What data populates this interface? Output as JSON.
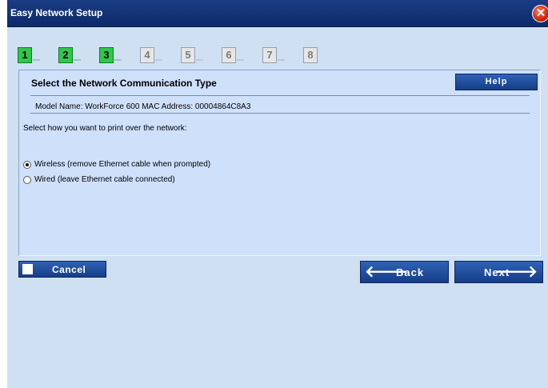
{
  "window": {
    "title": "Easy Network Setup",
    "close_glyph": "✕"
  },
  "steps": [
    {
      "num": "1",
      "dots": "▫▫▫",
      "state": "done"
    },
    {
      "num": "2",
      "dots": "▫▫▫",
      "state": "done"
    },
    {
      "num": "3",
      "dots": "▫▫▫",
      "state": "done"
    },
    {
      "num": "4",
      "dots": "▫▫▫",
      "state": "pending"
    },
    {
      "num": "5",
      "dots": "▫▫▫",
      "state": "pending"
    },
    {
      "num": "6",
      "dots": "▫▫▫",
      "state": "pending"
    },
    {
      "num": "7",
      "dots": "▫▫▫",
      "state": "pending"
    },
    {
      "num": "8",
      "dots": "",
      "state": "pending"
    }
  ],
  "panel": {
    "title": "Select the Network Communication Type",
    "help_label": "Help",
    "model_info": "Model Name: WorkForce 600    MAC Address: 00004864C8A3",
    "instruction": "Select how you want to print over the network:",
    "options": [
      {
        "label": "Wireless (remove Ethernet cable when prompted)",
        "checked": true
      },
      {
        "label": "Wired (leave Ethernet cable connected)",
        "checked": false
      }
    ]
  },
  "buttons": {
    "cancel": "Cancel",
    "back": "Back",
    "next": "Next",
    "back_arrow": "🡐",
    "next_arrow": "🡒"
  },
  "colors": {
    "titlebar": "#0d2a6a",
    "step_done": "#2ec84b",
    "panel_bg": "#cfe0fb",
    "window_bg": "#cfe0f2",
    "button": "#1f4a98"
  }
}
